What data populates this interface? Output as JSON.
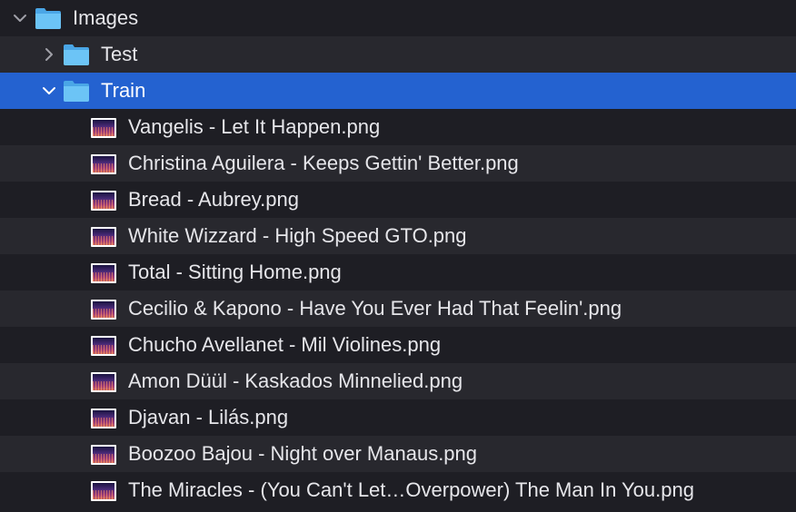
{
  "tree": {
    "root": {
      "label": "Images",
      "expanded": true,
      "icon": "folder-icon"
    },
    "folders": [
      {
        "label": "Test",
        "expanded": false,
        "icon": "folder-icon"
      },
      {
        "label": "Train",
        "expanded": true,
        "selected": true,
        "icon": "folder-icon"
      }
    ],
    "files": [
      {
        "label": "Vangelis - Let It Happen.png"
      },
      {
        "label": "Christina Aguilera - Keeps Gettin' Better.png"
      },
      {
        "label": "Bread - Aubrey.png"
      },
      {
        "label": "White Wizzard - High Speed GTO.png"
      },
      {
        "label": "Total - Sitting Home.png"
      },
      {
        "label": "Cecilio & Kapono - Have You Ever Had That Feelin'.png"
      },
      {
        "label": "Chucho Avellanet - Mil Violines.png"
      },
      {
        "label": "Amon Düül - Kaskados Minnelied.png"
      },
      {
        "label": "Djavan - Lilás.png"
      },
      {
        "label": "Boozoo Bajou - Night over Manaus.png"
      },
      {
        "label": "The Miracles - (You Can't Let…Overpower) The Man In You.png"
      }
    ]
  },
  "colors": {
    "selection": "#2462d0",
    "row_dark": "#1e1e24",
    "row_light": "#28282e",
    "folder": "#5bb8f0"
  }
}
